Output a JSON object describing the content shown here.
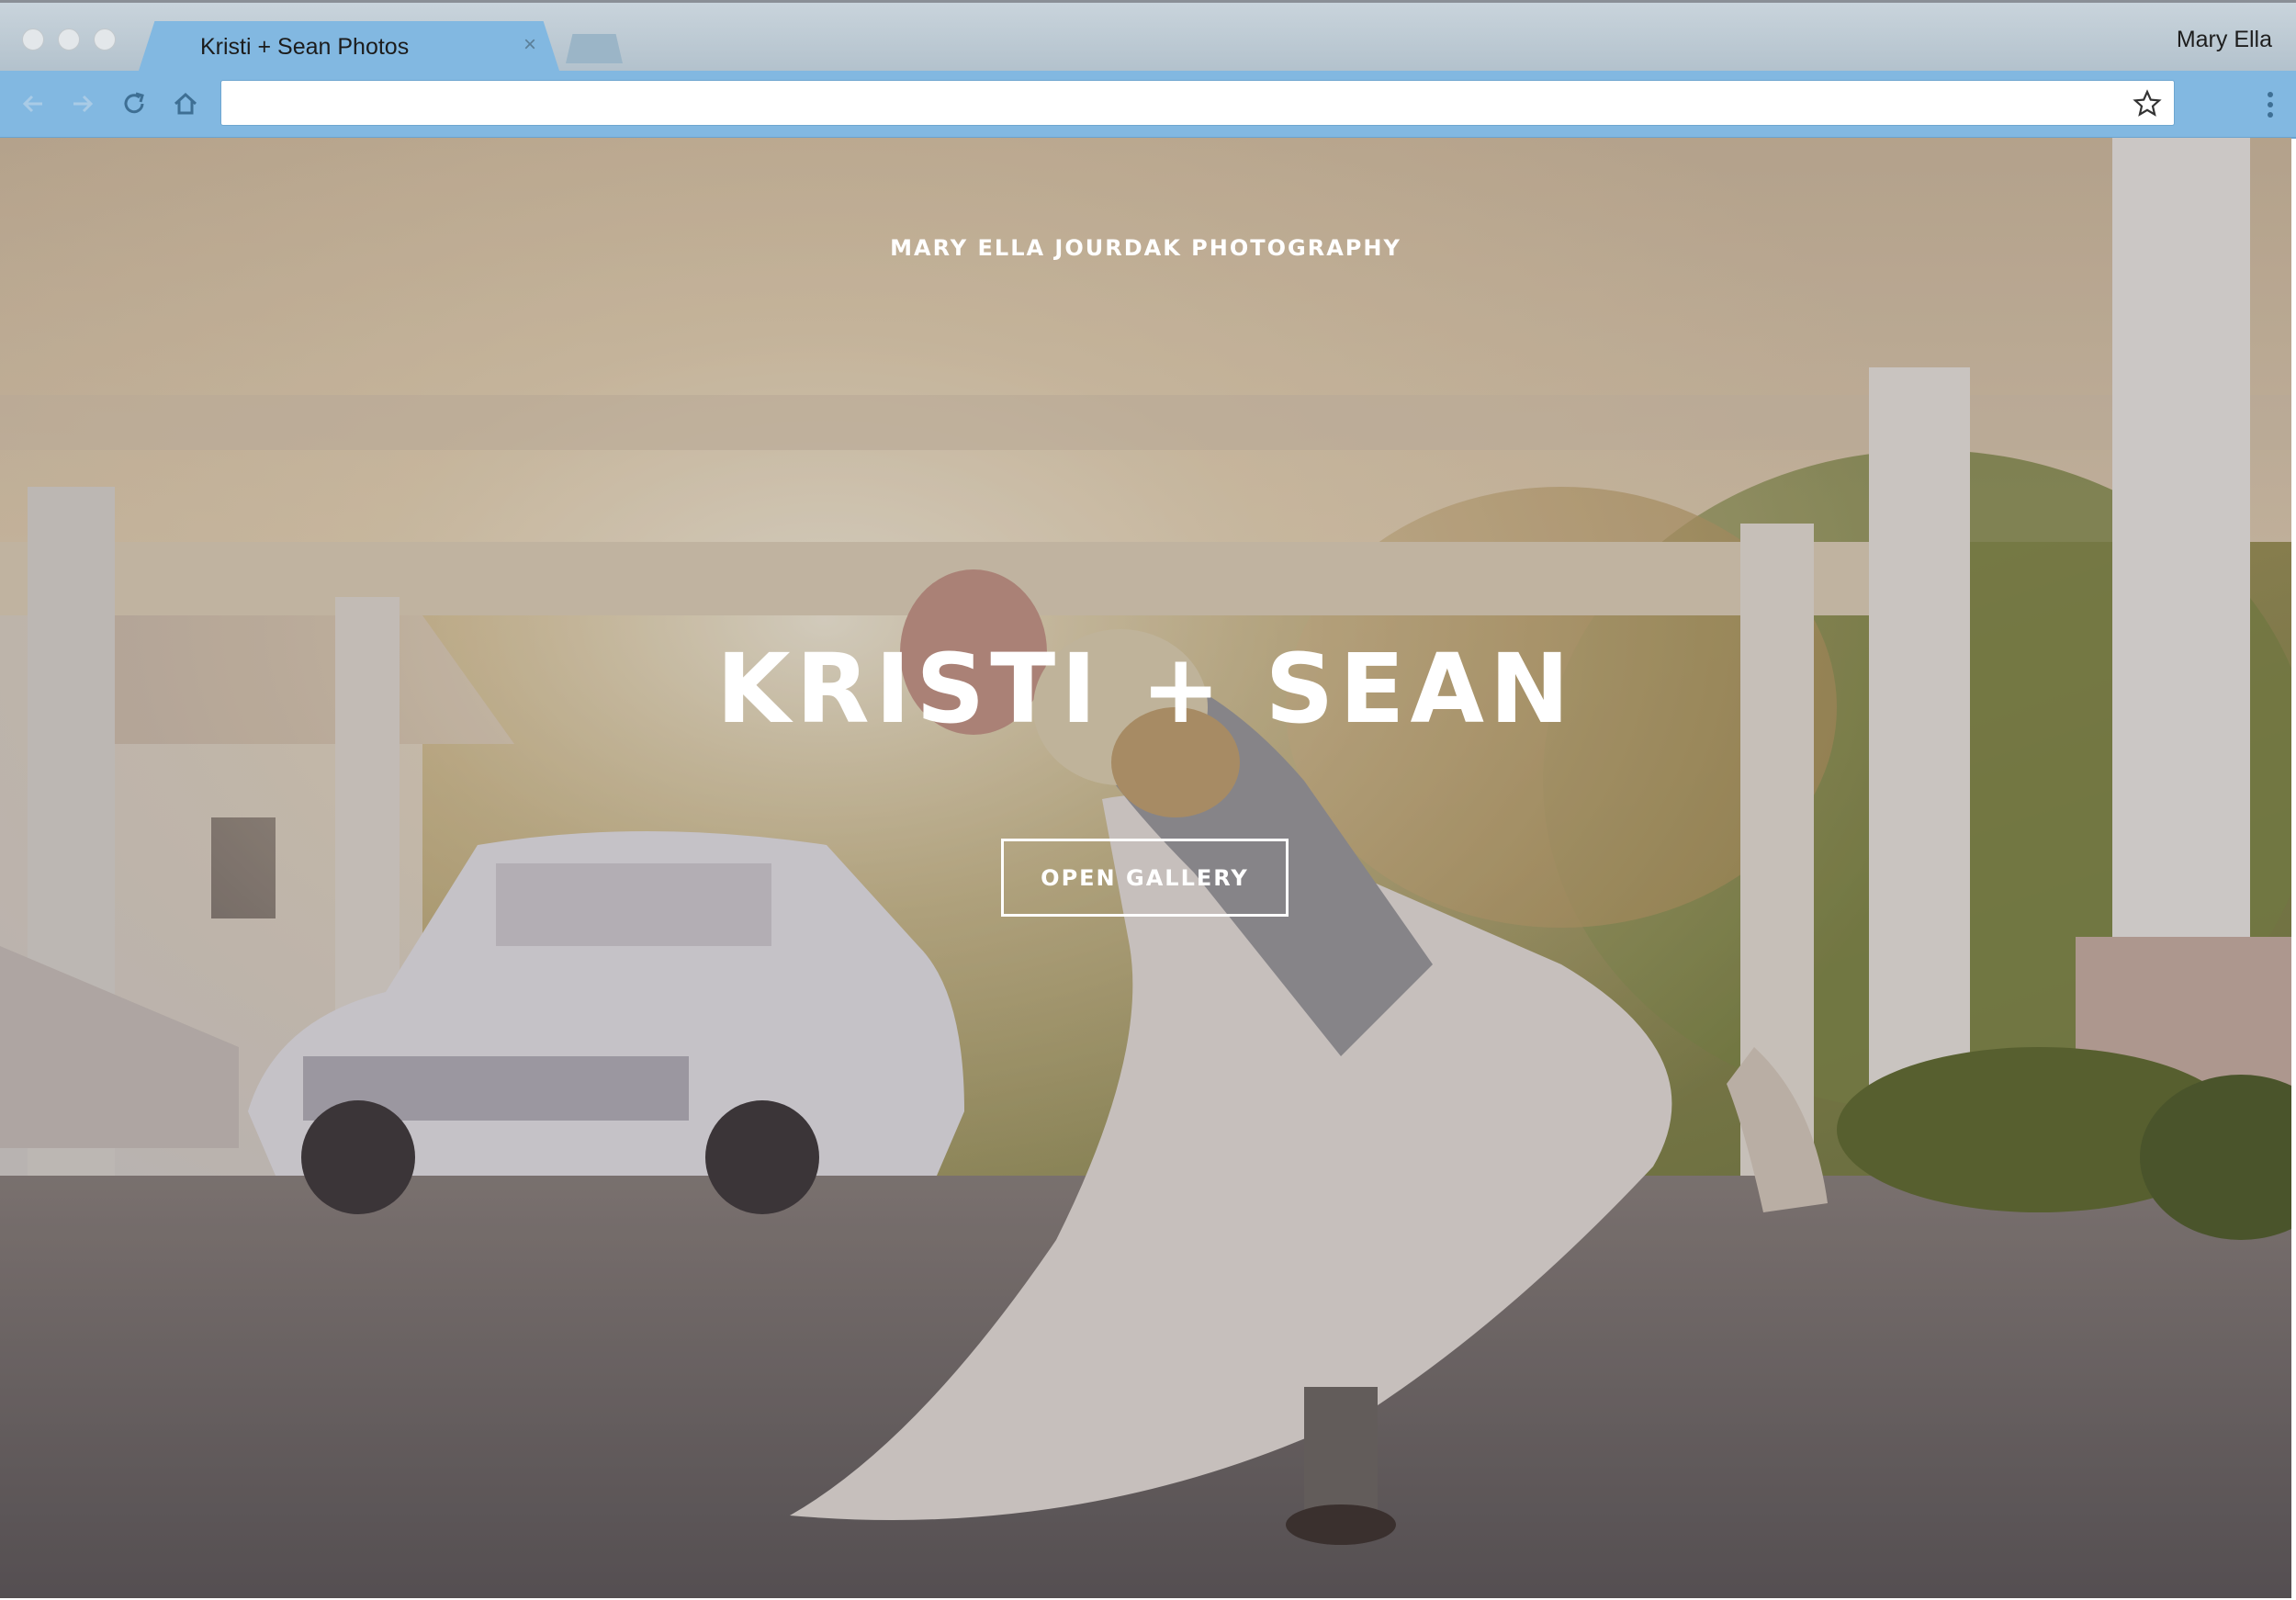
{
  "browser": {
    "tab_title": "Kristi + Sean Photos",
    "tab_close": "×",
    "profile_name": "Mary Ella",
    "address_value": "",
    "accent": "#82b8e1"
  },
  "icons": [
    "back-arrow-icon",
    "forward-arrow-icon",
    "reload-icon",
    "home-icon",
    "star-icon",
    "kebab-menu-icon",
    "close-icon"
  ],
  "hero": {
    "brand": "MARY ELLA JOURDAK PHOTOGRAPHY",
    "title": "KRISTI + SEAN",
    "cta_label": "OPEN GALLERY"
  }
}
